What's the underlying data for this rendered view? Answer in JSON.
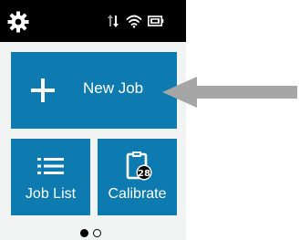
{
  "status_bar": {
    "settings_icon": "gear-icon",
    "data_icon": "data-transfer-icon",
    "wifi_icon": "wifi-icon",
    "battery_icon": "battery-icon"
  },
  "tiles": {
    "new_job": {
      "label": "New Job",
      "icon": "plus-icon"
    },
    "job_list": {
      "label": "Job List",
      "icon": "list-icon"
    },
    "calibrate": {
      "label": "Calibrate",
      "icon": "clipboard-calendar-icon",
      "badge": "28"
    }
  },
  "pager": {
    "current": 1,
    "total": 2
  },
  "colors": {
    "tile": "#0d7ab0",
    "status_bar": "#000000",
    "arrow": "#a6a6a6",
    "background": "#f2f3f3"
  }
}
